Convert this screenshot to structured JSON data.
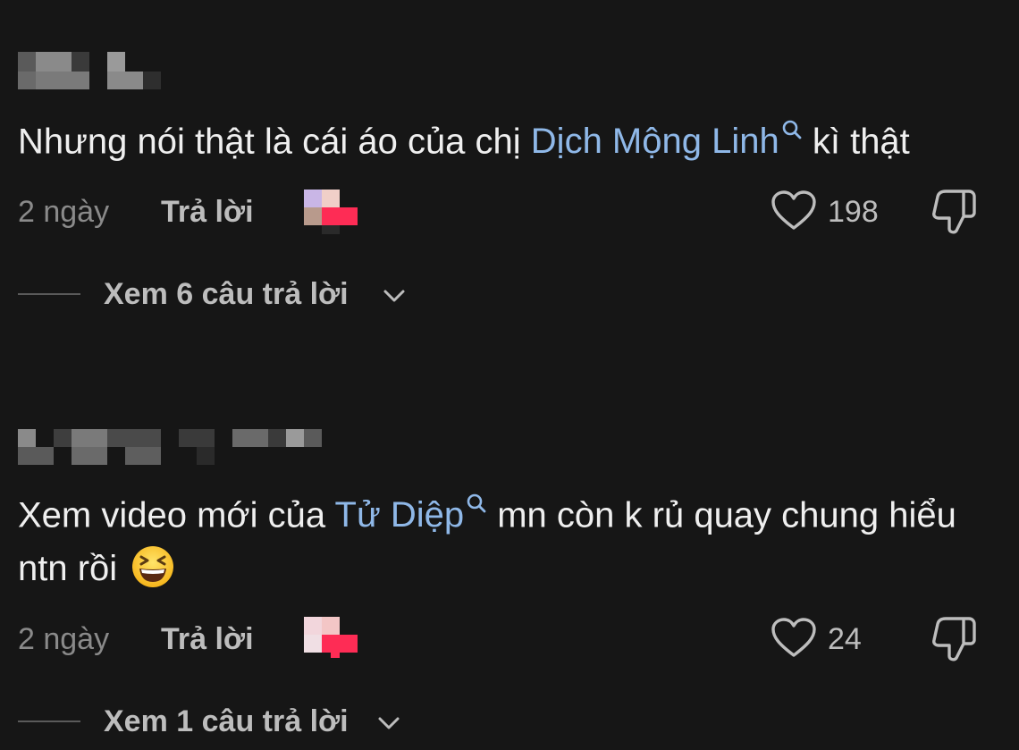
{
  "comments": [
    {
      "text_before": "Nhưng nói thật là cái áo của chị ",
      "mention": "Dịch Mộng Linh",
      "text_after": " kì thật",
      "time": "2 ngày",
      "reply_label": "Trả lời",
      "likes": "198",
      "view_replies": "Xem 6 câu trả lời"
    },
    {
      "text_before": "Xem video mới của ",
      "mention": "Tử Diệp",
      "text_after": " mn còn k rủ quay chung hiểu ntn rồi ",
      "emoji": "grinning-squinting-face",
      "time": "2 ngày",
      "reply_label": "Trả lời",
      "likes": "24",
      "view_replies": "Xem 1 câu trả lời"
    }
  ],
  "colors": {
    "background": "#161616",
    "text": "#efefef",
    "mention": "#8fb8e8",
    "muted": "#8a8a8a",
    "secondary": "#bdbdbd",
    "creator_badge": "#fe2c55"
  },
  "icons": {
    "search": "magnifier-icon",
    "like": "heart-outline-icon",
    "dislike": "thumbs-down-icon",
    "expand": "chevron-down-icon",
    "creator": "creator-liked-badge"
  }
}
